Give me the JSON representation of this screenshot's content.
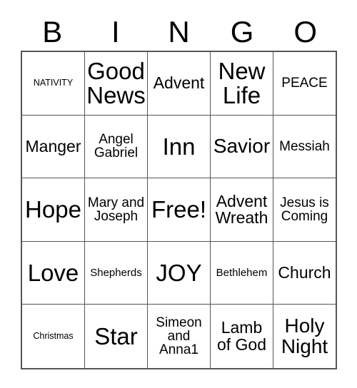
{
  "card": {
    "header": {
      "letters": [
        "B",
        "I",
        "N",
        "G",
        "O"
      ]
    },
    "rows": [
      [
        {
          "text": "NATIVITY",
          "size": "xs"
        },
        {
          "text": "Good News",
          "size": "xxl"
        },
        {
          "text": "Advent",
          "size": "lg"
        },
        {
          "text": "New Life",
          "size": "xxl"
        },
        {
          "text": "PEACE",
          "size": "md"
        }
      ],
      [
        {
          "text": "Manger",
          "size": "lg"
        },
        {
          "text": "Angel Gabriel",
          "size": "md"
        },
        {
          "text": "Inn",
          "size": "xxl"
        },
        {
          "text": "Savior",
          "size": "xl"
        },
        {
          "text": "Messiah",
          "size": "md"
        }
      ],
      [
        {
          "text": "Hope",
          "size": "xxl"
        },
        {
          "text": "Mary and Joseph",
          "size": "md"
        },
        {
          "text": "Free!",
          "size": "xxl"
        },
        {
          "text": "Advent Wreath",
          "size": "lg"
        },
        {
          "text": "Jesus is Coming",
          "size": "md"
        }
      ],
      [
        {
          "text": "Love",
          "size": "xxl"
        },
        {
          "text": "Shepherds",
          "size": "sm"
        },
        {
          "text": "JOY",
          "size": "xxl"
        },
        {
          "text": "Bethlehem",
          "size": "sm"
        },
        {
          "text": "Church",
          "size": "lg"
        }
      ],
      [
        {
          "text": "Christmas",
          "size": "xs"
        },
        {
          "text": "Star",
          "size": "xxl"
        },
        {
          "text": "Simeon and Anna1",
          "size": "md"
        },
        {
          "text": "Lamb of God",
          "size": "lg"
        },
        {
          "text": "Holy Night",
          "size": "xl"
        }
      ]
    ],
    "free_space": {
      "row": 2,
      "col": 2,
      "label": "Free!"
    },
    "colors": {
      "background": "#ffffff",
      "text": "#000000",
      "grid_line": "#555555"
    }
  }
}
